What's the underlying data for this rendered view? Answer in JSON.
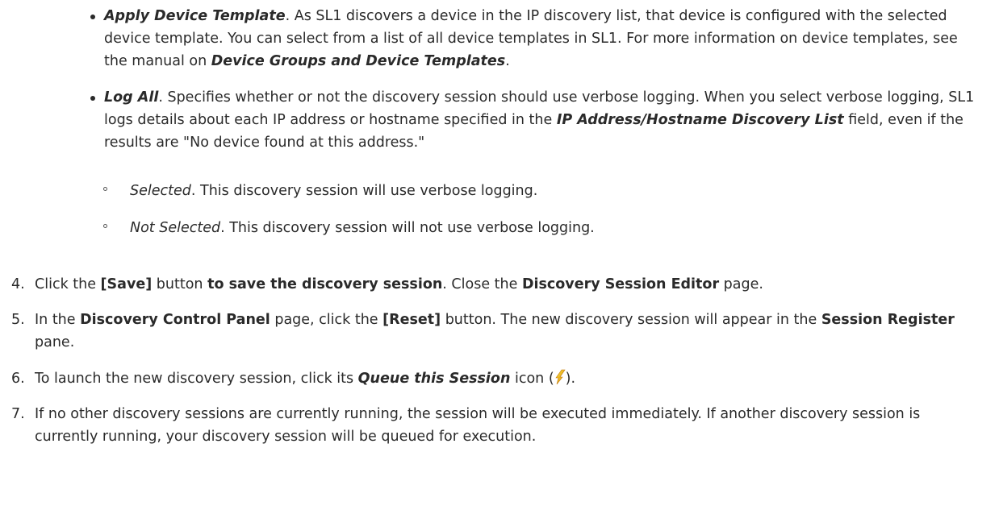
{
  "bullets": {
    "apply_template": {
      "term": "Apply Device Template",
      "text_a": ". As SL1 discovers a device in the IP discovery list, that device is configured with the selected device template. You can select from a list of all device templates in SL1. For more information on device templates, see the manual on ",
      "manual_link": "Device Groups and Device Templates",
      "text_b": "."
    },
    "log_all": {
      "term": "Log All",
      "text_a": ". Specifies whether or not the discovery session should use verbose logging. When you select verbose logging, SL1 logs details about each IP address or hostname specified in the ",
      "field": "IP Address/Hostname Discovery List",
      "text_b": " field, even if the results are \"No device found at this address.\""
    }
  },
  "sub_options": [
    {
      "term": "Selected",
      "text": ". This discovery session will use verbose logging."
    },
    {
      "term": "Not Selected",
      "text": ". This discovery session will not use verbose logging."
    }
  ],
  "steps": {
    "s4": {
      "num": "4.",
      "t1": "Click the ",
      "button": "[Save]",
      "t2": " button ",
      "bold_phrase": "to save the discovery session",
      "t3": ". Close the ",
      "page": "Discovery Session Editor",
      "t4": " page."
    },
    "s5": {
      "num": "5.",
      "t1": "In the ",
      "page": "Discovery Control Panel",
      "t2": " page, click the ",
      "button": "[Reset]",
      "t3": " button. The new discovery session will appear in the ",
      "pane": "Session Register",
      "t4": " pane."
    },
    "s6": {
      "num": "6.",
      "t1": "To launch the new discovery session, click its ",
      "icon_name": "Queue this Session",
      "t2": " icon (",
      "t3": ")."
    },
    "s7": {
      "num": "7.",
      "text": "If no other discovery sessions are currently running, the session will be executed immediately. If another discovery session is currently running, your discovery session will be queued for execution."
    }
  },
  "icons": {
    "queue": "lightning-bolt-icon"
  },
  "colors": {
    "text": "#2a2a2a",
    "icon_yellow": "#f2d020",
    "icon_orange": "#e08a10"
  }
}
